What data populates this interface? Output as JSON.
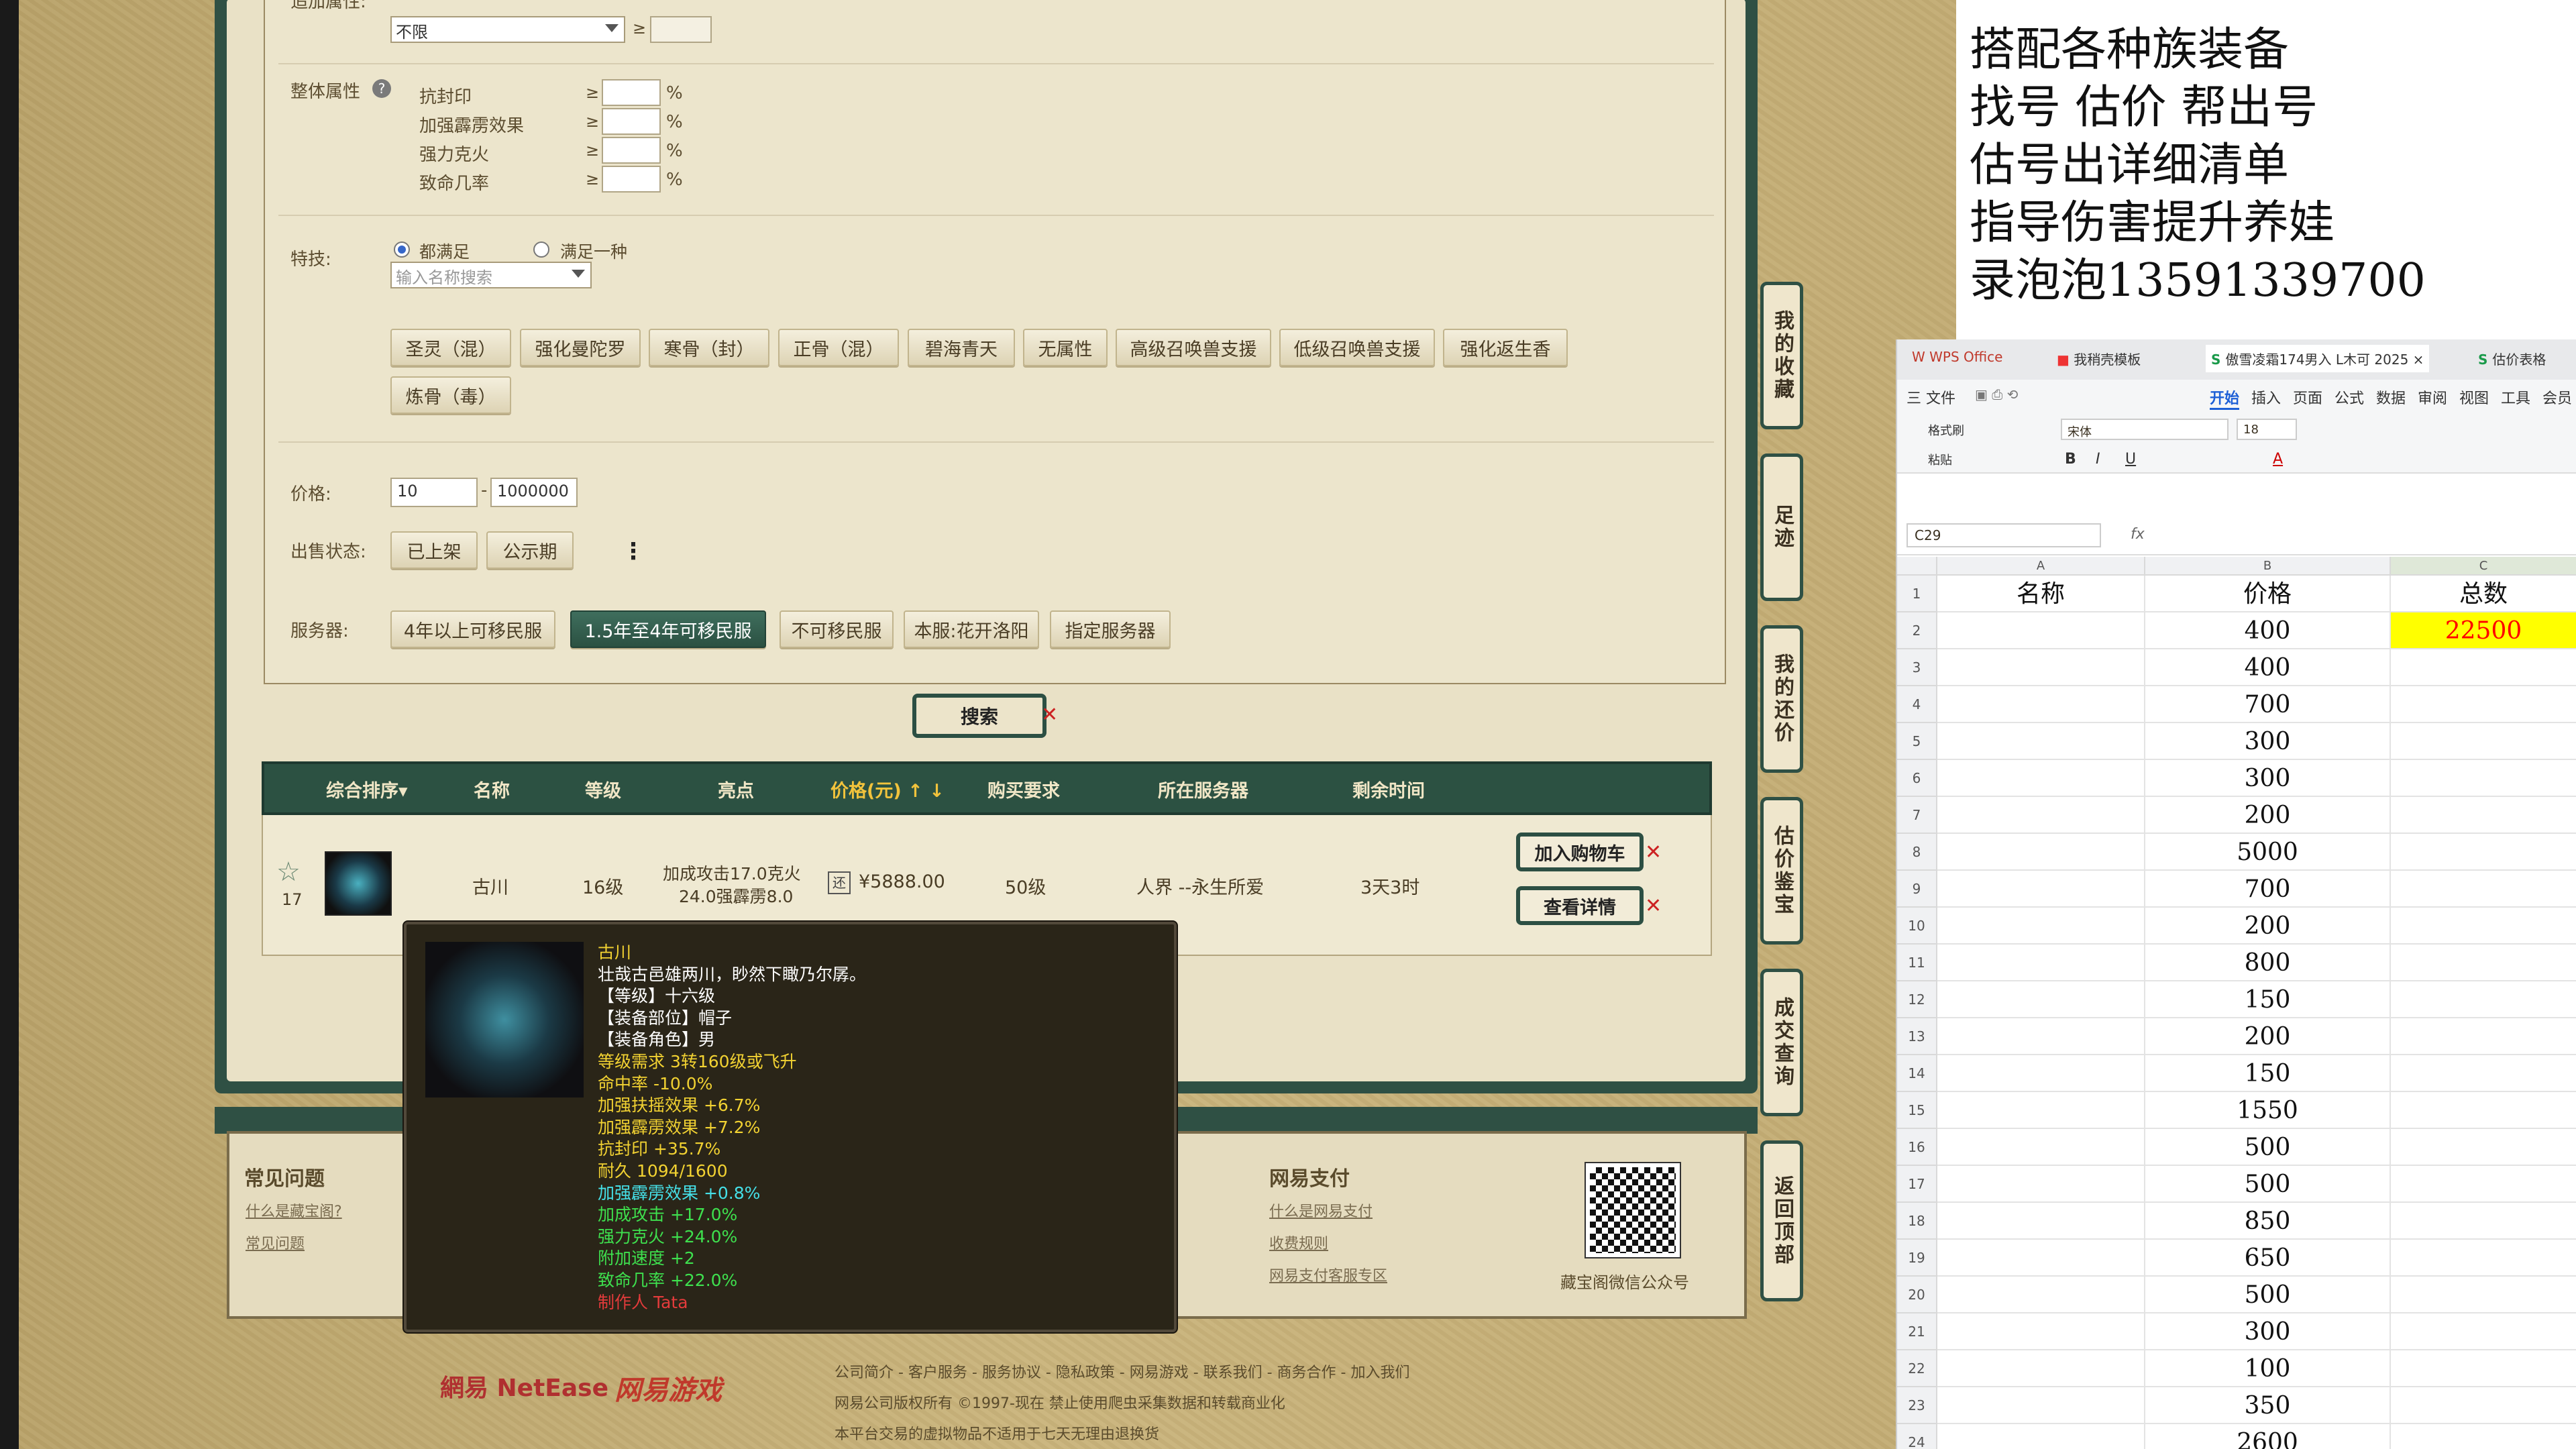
{
  "filter": {
    "top_label": "追加属性:",
    "top_dropdown": "不限",
    "ge": "≥",
    "overall_label": "整体属性",
    "overall_rows": [
      "抗封印",
      "加强霹雳效果",
      "强力克火",
      "致命几率"
    ],
    "percent": "%",
    "skill_label": "特技:",
    "radio_all": "都满足",
    "radio_any": "满足一种",
    "skill_search_placeholder": "输入名称搜索",
    "skill_chips": [
      "圣灵（混）",
      "强化曼陀罗",
      "寒骨（封）",
      "正骨（混）",
      "碧海青天",
      "无属性",
      "高级召唤兽支援",
      "低级召唤兽支援",
      "强化返生香",
      "炼骨（毒）"
    ],
    "price_label": "价格:",
    "price_min": "10",
    "price_dash": "-",
    "price_max": "1000000",
    "sale_label": "出售状态:",
    "sale_chips": [
      "已上架",
      "公示期"
    ],
    "more": "⋮",
    "server_label": "服务器:",
    "server_chips": [
      "4年以上可移民服",
      "1.5年至4年可移民服",
      "不可移民服",
      "本服:花开洛阳",
      "指定服务器"
    ],
    "search_button": "搜索"
  },
  "table": {
    "headers": [
      "综合排序",
      "名称",
      "等级",
      "亮点",
      "价格(元)",
      "购买要求",
      "所在服务器",
      "剩余时间"
    ],
    "sort_arrow": "▾",
    "price_arrows": "↑ ↓",
    "row": {
      "fav_count": "17",
      "name": "古川",
      "level": "16级",
      "highlight1": "加成攻击17.0克火",
      "highlight2": "24.0强霹雳8.0",
      "price_tag": "¥5888.00",
      "requirement": "50级",
      "server": "人界 --永生所爱",
      "remaining": "3天3时",
      "add_cart": "加入购物车",
      "view_detail": "查看详情"
    }
  },
  "tooltip": {
    "lines": [
      {
        "text": "古川",
        "color": "#f2d232"
      },
      {
        "text": "壮哉古邑雄两川，眇然下瞰乃尔孱。",
        "color": "#ffffff"
      },
      {
        "text": "【等级】十六级",
        "color": "#ffffff"
      },
      {
        "text": "【装备部位】帽子",
        "color": "#ffffff"
      },
      {
        "text": "【装备角色】男",
        "color": "#ffffff"
      },
      {
        "text": "等级需求 3转160级或飞升",
        "color": "#f2d232"
      },
      {
        "text": "命中率 -10.0%",
        "color": "#f2d232"
      },
      {
        "text": "加强扶摇效果 +6.7%",
        "color": "#f2d232"
      },
      {
        "text": "加强霹雳效果 +7.2%",
        "color": "#f2d232"
      },
      {
        "text": "抗封印 +35.7%",
        "color": "#f2d232"
      },
      {
        "text": "耐久 1094/1600",
        "color": "#f2d232"
      },
      {
        "text": "加强霹雳效果 +0.8%",
        "color": "#45e0e8"
      },
      {
        "text": "加成攻击 +17.0%",
        "color": "#3ee04e"
      },
      {
        "text": "强力克火 +24.0%",
        "color": "#3ee04e"
      },
      {
        "text": "附加速度 +2",
        "color": "#3ee04e"
      },
      {
        "text": "致命几率 +22.0%",
        "color": "#3ee04e"
      },
      {
        "text": "制作人 Tata",
        "color": "#e33b3b"
      }
    ]
  },
  "footer": {
    "faq_title": "常见问题",
    "faq_links": [
      "什么是藏宝阁?",
      "常见问题"
    ],
    "pay_title": "网易支付",
    "pay_links": [
      "什么是网易支付",
      "收费规则",
      "网易支付客服专区"
    ],
    "wechat_label": "藏宝阁微信公众号",
    "brand1": "網易 NetEase",
    "brand2": "网易游戏",
    "links_line": "公司简介 - 客户服务 - 服务协议 - 隐私政策 - 网易游戏 - 联系我们 - 商务合作 - 加入我们",
    "copyright": "网易公司版权所有 ©1997-现在  禁止使用爬虫采集数据和转载商业化",
    "notice": "本平台交易的虚拟物品不适用于七天无理由退换货"
  },
  "side_tabs": [
    "我的收藏",
    "足迹",
    "我的还价",
    "估价鉴宝",
    "成交查询",
    "返回顶部"
  ],
  "ad_lines": [
    " 搭配各种族装备",
    "找号  估价  帮出号",
    " 估号出详细清单",
    "指导伤害提升养娃",
    "录泡泡13591339700"
  ],
  "wps": {
    "tabs": [
      "WPS Office",
      "我稍壳模板",
      "傲雪凌霜174男入 L木可 2025",
      "估价表格"
    ],
    "tab_close": "×",
    "menu": [
      "三 文件",
      "开始",
      "插入",
      "页面",
      "公式",
      "数据",
      "审阅",
      "视图",
      "工具",
      "会员"
    ],
    "toolbar_labels": [
      "格式刷",
      "粘贴"
    ],
    "font_name": "宋体",
    "font_size": "18",
    "cell_ref": "C29",
    "fx": "fx",
    "col_letters": [
      "A",
      "B",
      "C"
    ],
    "headers": [
      "名称",
      "价格",
      "总数"
    ],
    "rows": [
      [
        "",
        "400",
        "22500"
      ],
      [
        "",
        "400",
        ""
      ],
      [
        "",
        "700",
        ""
      ],
      [
        "",
        "300",
        ""
      ],
      [
        "",
        "300",
        ""
      ],
      [
        "",
        "200",
        ""
      ],
      [
        "",
        "5000",
        ""
      ],
      [
        "",
        "700",
        ""
      ],
      [
        "",
        "200",
        ""
      ],
      [
        "",
        "800",
        ""
      ],
      [
        "",
        "150",
        ""
      ],
      [
        "",
        "200",
        ""
      ],
      [
        "",
        "150",
        ""
      ],
      [
        "",
        "1550",
        ""
      ],
      [
        "",
        "500",
        ""
      ],
      [
        "",
        "500",
        ""
      ],
      [
        "",
        "850",
        ""
      ],
      [
        "",
        "650",
        ""
      ],
      [
        "",
        "500",
        ""
      ],
      [
        "",
        "300",
        ""
      ],
      [
        "",
        "100",
        ""
      ],
      [
        "",
        "350",
        ""
      ],
      [
        "",
        "2600",
        ""
      ]
    ],
    "highlight_color": "#ffff00",
    "highlight_text_color": "#ff0000"
  }
}
